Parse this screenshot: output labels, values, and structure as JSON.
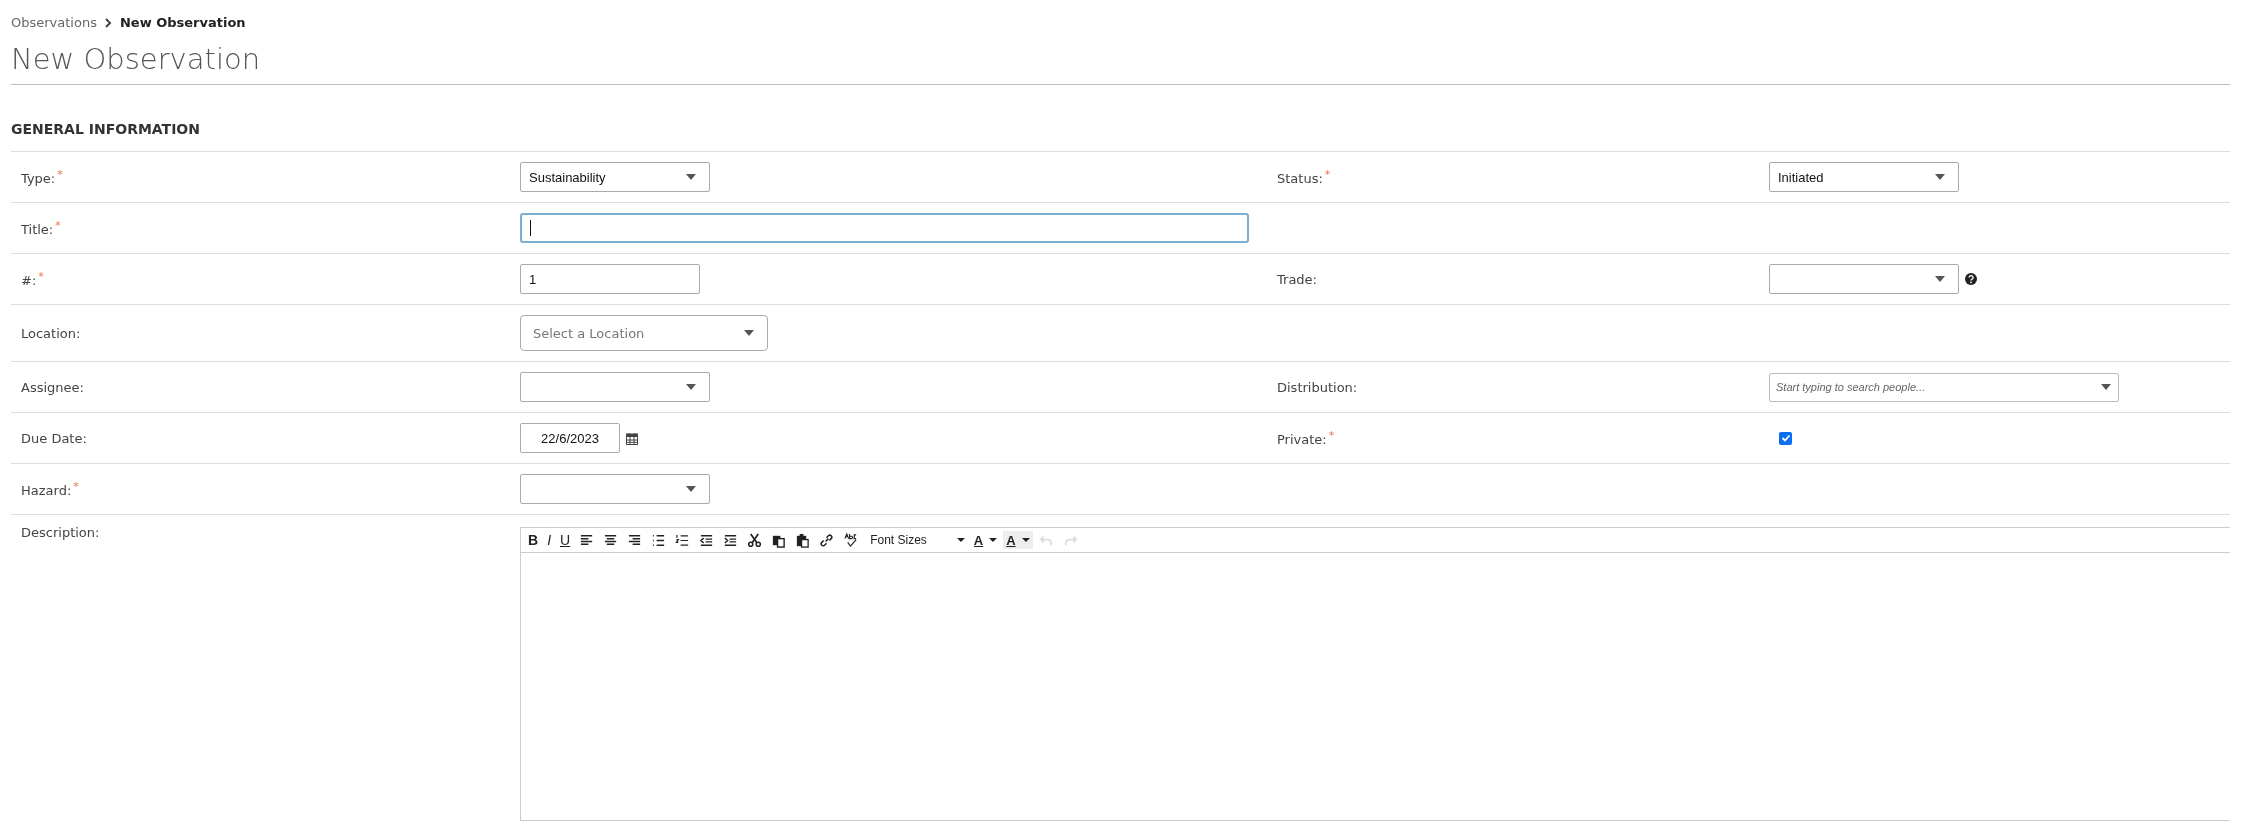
{
  "breadcrumb": {
    "items": [
      "Observations"
    ],
    "current": "New Observation"
  },
  "page_title": "New Observation",
  "section_title": "GENERAL INFORMATION",
  "required_mark": "*",
  "rows": [
    {
      "left": {
        "label": "Type:",
        "required": true,
        "kind": "select",
        "value": "Sustainability"
      },
      "right": {
        "label": "Status:",
        "required": true,
        "kind": "select",
        "value": "Initiated"
      }
    },
    {
      "left": {
        "label": "Title:",
        "required": true,
        "kind": "text",
        "focused": true
      }
    },
    {
      "left": {
        "label": "#:",
        "required": true,
        "kind": "text",
        "value": "1",
        "focused": false
      },
      "right": {
        "label": "Trade:",
        "required": false,
        "kind": "select",
        "help": true
      }
    },
    {
      "left": {
        "label": "Location:",
        "required": false,
        "kind": "combobox",
        "placeholder": "Select a Location"
      }
    },
    {
      "left": {
        "label": "Assignee:",
        "required": false,
        "kind": "select"
      },
      "right": {
        "label": "Distribution:",
        "required": false,
        "kind": "tokenfield",
        "placeholder": "Start typing to search people..."
      }
    },
    {
      "left": {
        "label": "Due Date:",
        "required": false,
        "kind": "date",
        "value": "22/6/2023"
      },
      "right": {
        "label": "Private:",
        "required": true,
        "kind": "checkbox",
        "checked": true
      }
    },
    {
      "left": {
        "label": "Hazard:",
        "required": true,
        "kind": "select"
      }
    },
    {
      "left": {
        "label": "Description:",
        "required": false,
        "kind": "editor",
        "toolbar": [
          {
            "kind": "bold",
            "label": "B",
            "disabled": false
          },
          {
            "kind": "italic",
            "label": "I",
            "disabled": false
          },
          {
            "kind": "underline",
            "label": "U",
            "disabled": false
          },
          {
            "kind": "align-left",
            "disabled": false
          },
          {
            "kind": "align-center",
            "disabled": false
          },
          {
            "kind": "align-right",
            "disabled": false
          },
          {
            "kind": "bullets",
            "disabled": false
          },
          {
            "kind": "numbers",
            "disabled": false
          },
          {
            "kind": "outdent",
            "disabled": false
          },
          {
            "kind": "indent",
            "disabled": false
          },
          {
            "kind": "cut",
            "disabled": false
          },
          {
            "kind": "copy",
            "disabled": false
          },
          {
            "kind": "paste",
            "disabled": false
          },
          {
            "kind": "link",
            "disabled": false
          },
          {
            "kind": "spellcheck",
            "disabled": false
          },
          {
            "kind": "dropdown",
            "label": "Font Sizes",
            "disabled": false
          },
          {
            "kind": "color",
            "label": "A",
            "disabled": false
          },
          {
            "kind": "highlight",
            "label": "A",
            "disabled": false
          },
          {
            "kind": "undo",
            "disabled": true
          },
          {
            "kind": "redo",
            "disabled": true
          }
        ]
      }
    }
  ]
}
